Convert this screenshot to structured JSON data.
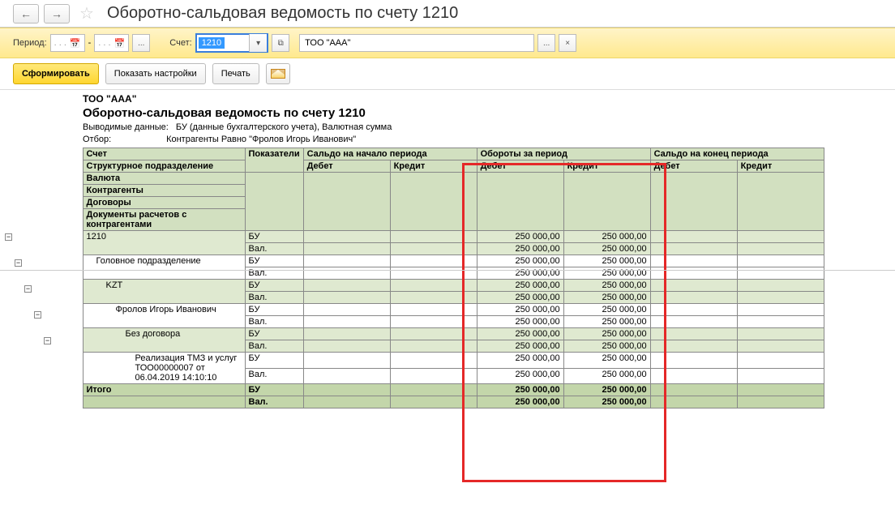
{
  "nav": {
    "back": "←",
    "forward": "→",
    "star": "☆"
  },
  "title": "Оборотно-сальдовая ведомость по счету 1210",
  "period": {
    "label": "Период:",
    "date_from": ". .  .    ",
    "dash": "-",
    "date_to": ". .  .    ",
    "ellipsis": "...",
    "account_label": "Счет:",
    "account_value": "1210",
    "dropdown": "▾",
    "expand": "⧉",
    "org_value": "ТОО \"ААА\"",
    "org_ellipsis": "...",
    "org_clear": "×"
  },
  "toolbar": {
    "form": "Сформировать",
    "settings": "Показать настройки",
    "print": "Печать"
  },
  "report": {
    "org": "ТОО \"ААА\"",
    "title": "Оборотно-сальдовая ведомость по счету 1210",
    "meta1_label": "Выводимые данные:",
    "meta1_value": "БУ (данные бухгалтерского учета), Валютная сумма",
    "meta2_label": "Отбор:",
    "meta2_value": "Контрагенты Равно \"Фролов Игорь Иванович\""
  },
  "headers": {
    "account": "Счет",
    "indicators": "Показатели",
    "open_bal": "Сальдо на начало периода",
    "turnover": "Обороты за период",
    "close_bal": "Сальдо на конец периода",
    "debit": "Дебет",
    "credit": "Кредит",
    "row2": "Структурное подразделение",
    "row3": "Валюта",
    "row4": "Контрагенты",
    "row5": "Договоры",
    "row6": "Документы расчетов с контрагентами"
  },
  "rows": [
    {
      "name": "1210",
      "bu": "БУ",
      "val": "Вал.",
      "bu_d": "250 000,00",
      "bu_c": "250 000,00",
      "val_d": "250 000,00",
      "val_c": "250 000,00",
      "cls": "alt",
      "indent": 0
    },
    {
      "name": "Головное подразделение",
      "bu": "БУ",
      "val": "Вал.",
      "bu_d": "250 000,00",
      "bu_c": "250 000,00",
      "val_d": "250 000,00",
      "val_c": "250 000,00",
      "cls": "",
      "indent": 1
    },
    {
      "name": "KZT",
      "bu": "БУ",
      "val": "Вал.",
      "bu_d": "250 000,00",
      "bu_c": "250 000,00",
      "val_d": "250 000,00",
      "val_c": "250 000,00",
      "cls": "alt",
      "indent": 2
    },
    {
      "name": "Фролов Игорь Иванович",
      "bu": "БУ",
      "val": "Вал.",
      "bu_d": "250 000,00",
      "bu_c": "250 000,00",
      "val_d": "250 000,00",
      "val_c": "250 000,00",
      "cls": "",
      "indent": 3
    },
    {
      "name": "Без договора",
      "bu": "БУ",
      "val": "Вал.",
      "bu_d": "250 000,00",
      "bu_c": "250 000,00",
      "val_d": "250 000,00",
      "val_c": "250 000,00",
      "cls": "alt",
      "indent": 4
    },
    {
      "name": "Реализация ТМЗ и услуг ТОО00000007 от 06.04.2019 14:10:10",
      "bu": "БУ",
      "val": "Вал.",
      "bu_d": "250 000,00",
      "bu_c": "250 000,00",
      "val_d": "250 000,00",
      "val_c": "250 000,00",
      "cls": "",
      "indent": 5,
      "wrap": true
    }
  ],
  "total": {
    "name": "Итого",
    "bu": "БУ",
    "val": "Вал.",
    "bu_d": "250 000,00",
    "bu_c": "250 000,00",
    "val_d": "250 000,00",
    "val_c": "250 000,00"
  }
}
